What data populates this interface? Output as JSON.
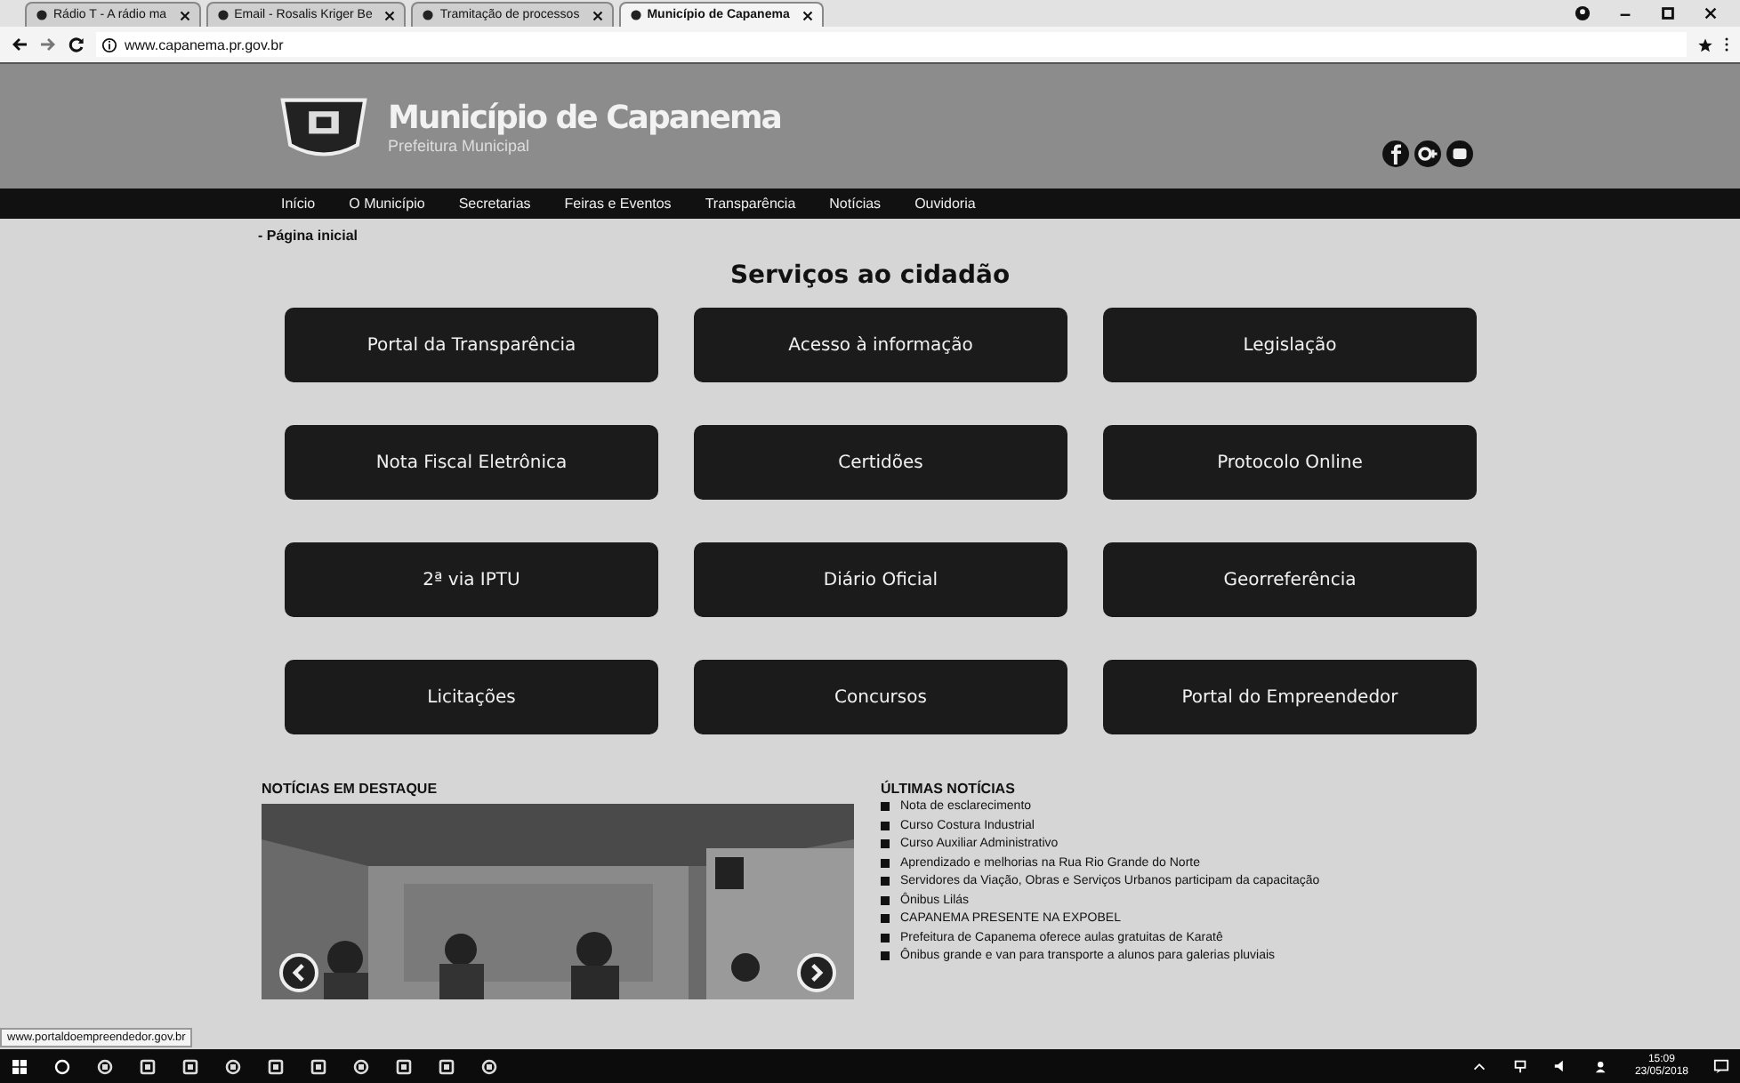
{
  "browser": {
    "tabs": [
      {
        "label": "Rádio T - A rádio ma",
        "selected": false
      },
      {
        "label": "Email - Rosalis Kriger Be",
        "selected": false
      },
      {
        "label": "Tramitação de processos",
        "selected": false
      },
      {
        "label": "Município de Capanema",
        "selected": true
      }
    ],
    "url": "www.capanema.pr.gov.br"
  },
  "header": {
    "title": "Município de Capanema",
    "subtitle": "Prefeitura Municipal"
  },
  "nav": [
    "Início",
    "O Município",
    "Secretarias",
    "Feiras e Eventos",
    "Transparência",
    "Notícias",
    "Ouvidoria"
  ],
  "breadcrumb": "- Página inicial",
  "services": {
    "title": "Serviços ao cidadão",
    "buttons": [
      "Portal da Transparência",
      "Acesso à informação",
      "Legislação",
      "Nota Fiscal Eletrônica",
      "Certidões",
      "Protocolo Online",
      "2ª via IPTU",
      "Diário Oficial",
      "Georreferência",
      "Licitações",
      "Concursos",
      "Portal do Empreendedor"
    ]
  },
  "featured": {
    "title": "NOTÍCIAS EM DESTAQUE",
    "kind": "picture"
  },
  "latest": {
    "title": "ÚLTIMAS NOTÍCIAS",
    "items": [
      "Nota de esclarecimento",
      "Curso Costura Industrial",
      "Curso Auxiliar Administrativo",
      "Aprendizado e melhorias na Rua Rio Grande do Norte",
      "Servidores da Viação, Obras e Serviços Urbanos participam da capacitação",
      "Ônibus Lilás",
      "CAPANEMA PRESENTE NA EXPOBEL",
      "Prefeitura de Capanema oferece aulas gratuitas de Karatê",
      "Ônibus grande e van para transporte a alunos para galerias pluviais"
    ]
  },
  "status_url": "www.portaldoempreendedor.gov.br",
  "taskbar": {
    "time": "15:09",
    "date": "23/05/2018"
  }
}
